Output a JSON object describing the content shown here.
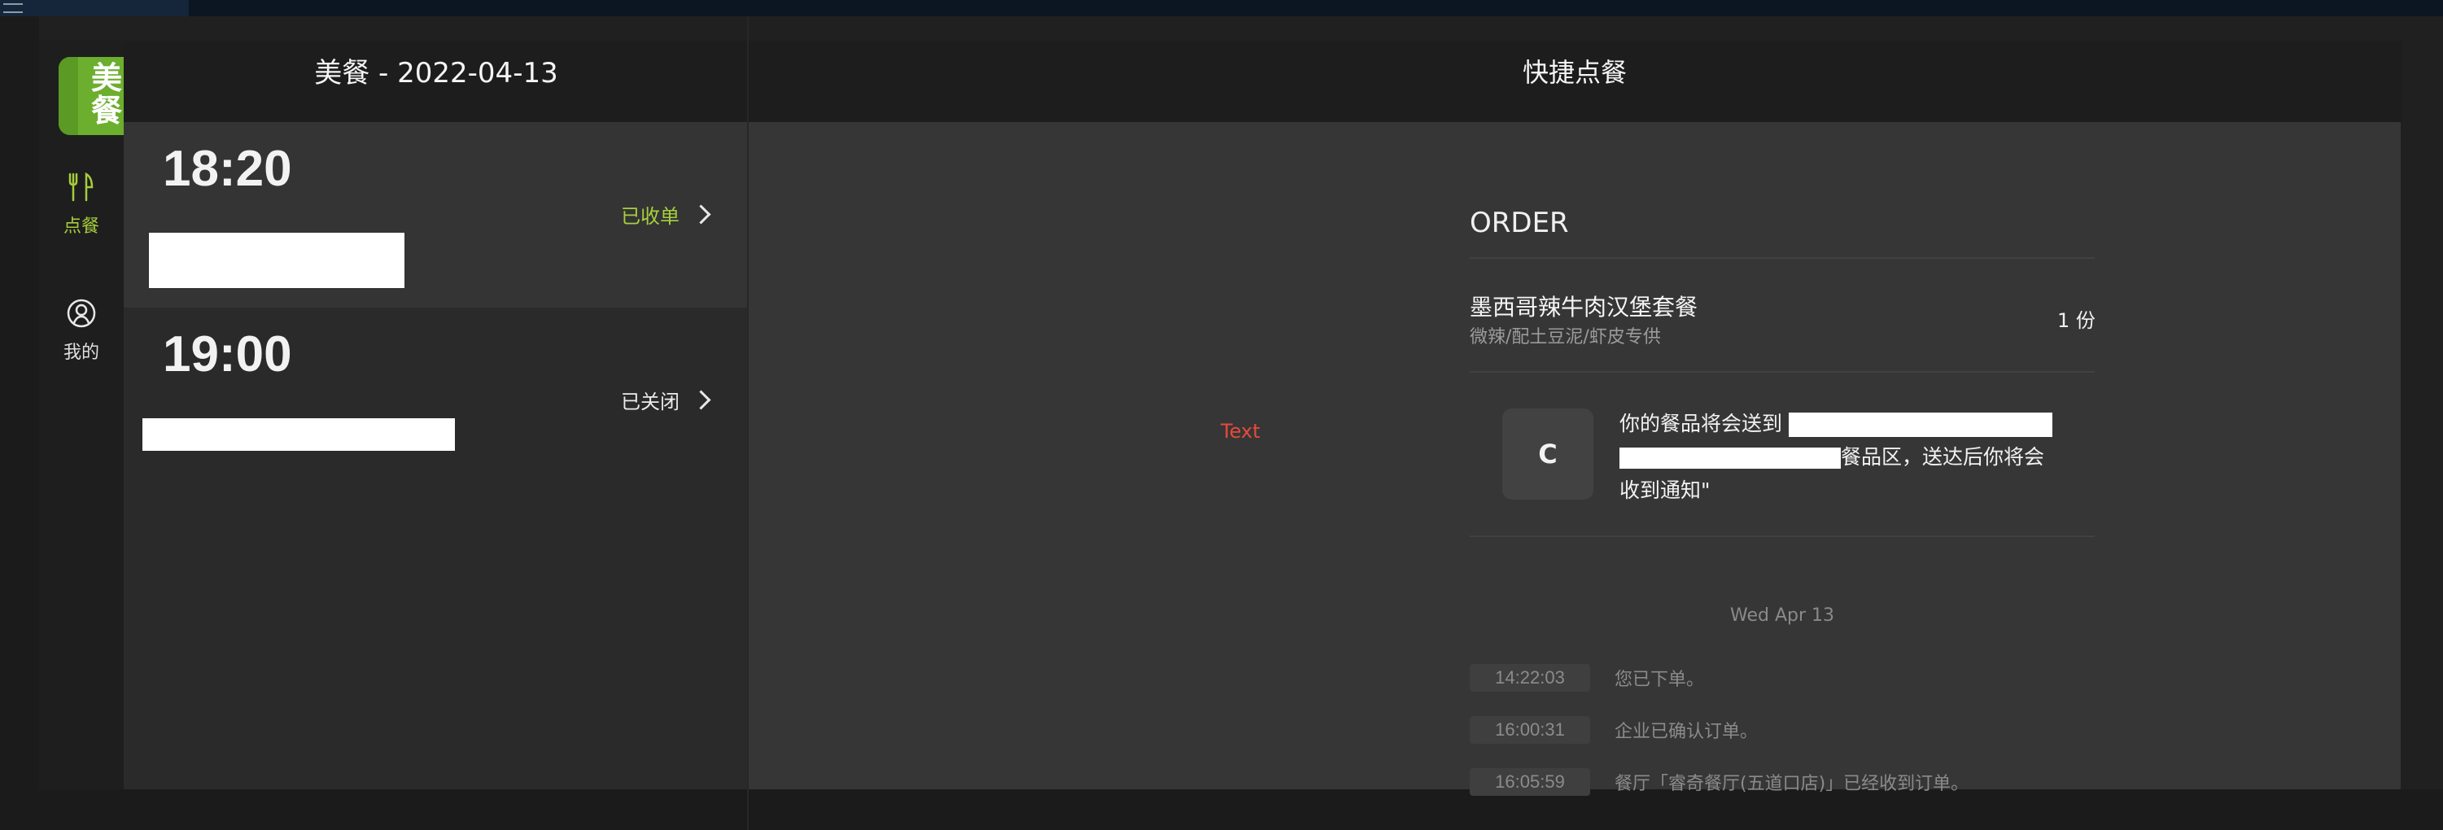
{
  "sidebar": {
    "logo_text": "美\n餐",
    "items": [
      {
        "label": "点餐",
        "icon": "fork-knife-icon",
        "active": true
      },
      {
        "label": "我的",
        "icon": "user-icon",
        "active": false
      }
    ]
  },
  "header": {
    "left_title": "美餐 - 2022-04-13",
    "right_title": "快捷点餐"
  },
  "orders": [
    {
      "time": "18:20",
      "status": "已收单",
      "status_color": "#a7cf3d"
    },
    {
      "time": "19:00",
      "status": "已关闭",
      "status_color": "#ececec"
    }
  ],
  "detail": {
    "placeholder": "Text",
    "section_title": "ORDER",
    "dish": {
      "name": "墨西哥辣牛肉汉堡套餐",
      "desc": "微辣/配土豆泥/虾皮专供",
      "qty": "1 份"
    },
    "message": {
      "avatar": "C",
      "line1": "你的餐品将会送到 ",
      "line2_end": "餐品区，送达后你将会",
      "line3": "收到通知\""
    },
    "date_label": "Wed Apr 13",
    "log": [
      {
        "time": "14:22:03",
        "text": "您已下单。"
      },
      {
        "time": "16:00:31",
        "text": "企业已确认订单。"
      },
      {
        "time": "16:05:59",
        "text": "餐厅「睿奇餐厅(五道口店)」已经收到订单。"
      }
    ]
  },
  "colors": {
    "accent": "#a6cc3c",
    "logo_bg": "#6cae2e",
    "placeholder_red": "#e64a3c"
  }
}
